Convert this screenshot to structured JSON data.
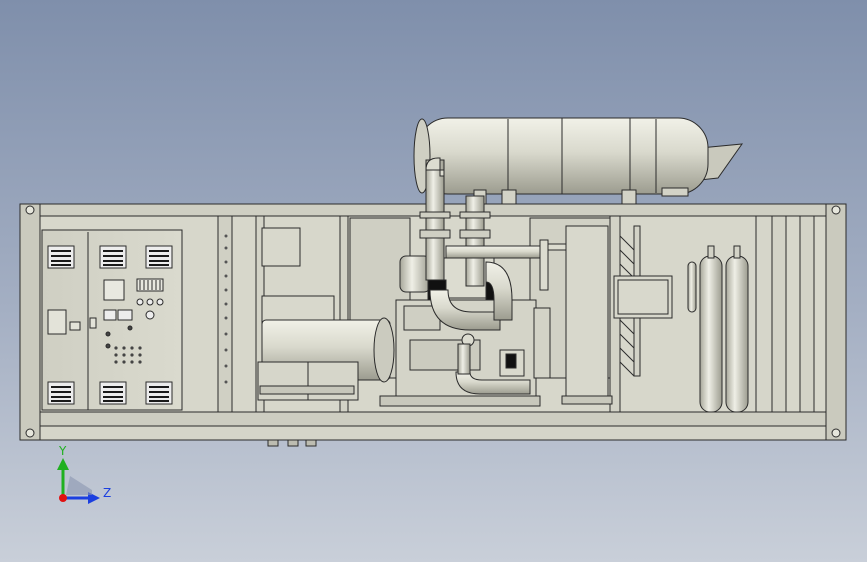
{
  "axes": {
    "y_label": "Y",
    "z_label": "Z"
  },
  "colors": {
    "bg_top": "#7f8fab",
    "bg_bottom": "#c7cdd8",
    "metal": "#dcdcd0",
    "metal_dark": "#b9b9ac",
    "outline": "#2b2b2b",
    "axis_y": "#20b020",
    "axis_z": "#1b3fe0",
    "axis_origin": "#e01010"
  }
}
